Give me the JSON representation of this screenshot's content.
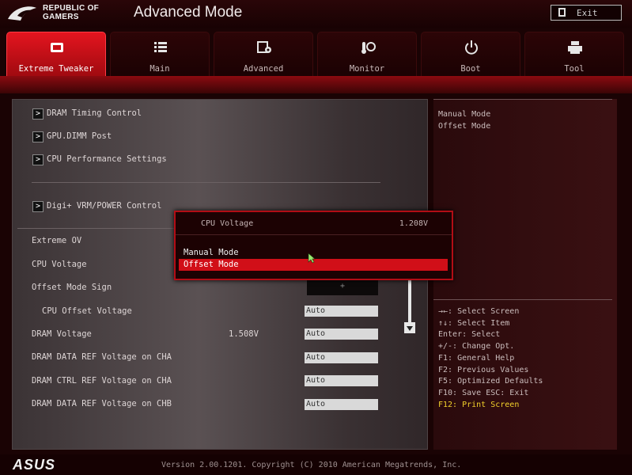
{
  "header": {
    "brand_line1": "REPUBLIC OF",
    "brand_line2": "GAMERS",
    "mode_title": "Advanced Mode",
    "exit_label": "Exit"
  },
  "tabs": [
    {
      "label": "Extreme Tweaker",
      "icon": "rog-eye-icon",
      "active": true
    },
    {
      "label": "Main",
      "icon": "list-icon",
      "active": false
    },
    {
      "label": "Advanced",
      "icon": "advanced-settings-icon",
      "active": false
    },
    {
      "label": "Monitor",
      "icon": "thermometer-fan-icon",
      "active": false
    },
    {
      "label": "Boot",
      "icon": "power-icon",
      "active": false
    },
    {
      "label": "Tool",
      "icon": "printer-tool-icon",
      "active": false
    }
  ],
  "menu": {
    "submenus": [
      {
        "label": "DRAM Timing Control"
      },
      {
        "label": "GPU.DIMM Post"
      },
      {
        "label": "CPU Performance Settings"
      },
      {
        "label": "Digi+ VRM/POWER Control"
      }
    ],
    "settings": [
      {
        "label": "Extreme OV",
        "value": ""
      },
      {
        "label": "CPU Voltage",
        "value": ""
      },
      {
        "label": "Offset Mode Sign",
        "value": "+"
      },
      {
        "label": "CPU Offset Voltage",
        "value": "Auto"
      },
      {
        "label": "DRAM Voltage",
        "reading": "1.508V",
        "value": "Auto"
      },
      {
        "label": "DRAM DATA REF Voltage on CHA",
        "value": "Auto"
      },
      {
        "label": "DRAM CTRL REF Voltage on CHA",
        "value": "Auto"
      },
      {
        "label": "DRAM DATA REF Voltage on CHB",
        "value": "Auto"
      }
    ]
  },
  "popup": {
    "title": "CPU Voltage",
    "value": "1.208V",
    "options": [
      "Manual Mode",
      "Offset Mode"
    ],
    "selected": "Offset Mode"
  },
  "help": {
    "options_lines": [
      "Manual Mode",
      "Offset Mode"
    ],
    "keys": [
      "→←: Select Screen",
      "↑↓: Select Item",
      "Enter: Select",
      "+/-: Change Opt.",
      "F1: General Help",
      "F2: Previous Values",
      "F5: Optimized Defaults",
      "F10: Save  ESC: Exit",
      "F12: Print Screen"
    ]
  },
  "footer": {
    "logo": "ASUS",
    "version": "Version 2.00.1201. Copyright (C) 2010 American Megatrends, Inc."
  },
  "colors": {
    "accent_red": "#d10f18",
    "highlight_yellow": "#f2d12b",
    "background": "#1a0304"
  }
}
